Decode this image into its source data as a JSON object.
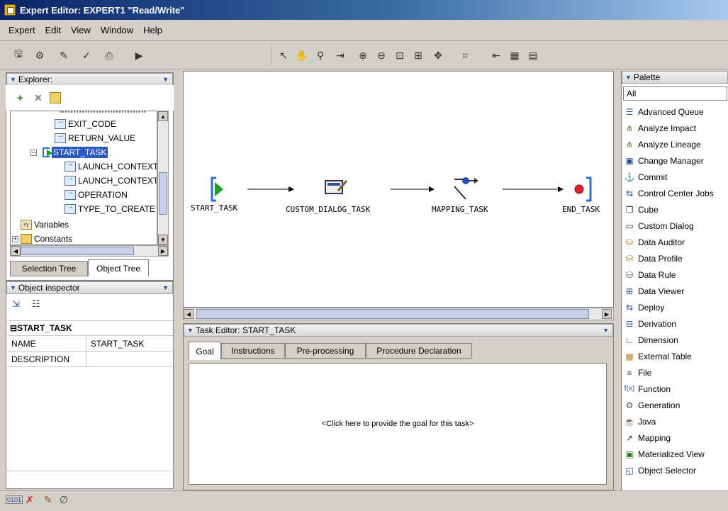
{
  "window": {
    "title": "Expert Editor: EXPERT1 \"Read/Write\""
  },
  "menu": [
    "Expert",
    "Edit",
    "View",
    "Window",
    "Help"
  ],
  "explorer": {
    "title": "Explorer:",
    "tree": [
      {
        "label": "EXIT_CODE",
        "type": "variable"
      },
      {
        "label": "RETURN_VALUE",
        "type": "variable"
      },
      {
        "label": "START_TASK",
        "type": "task",
        "selected": true
      },
      {
        "label": "LAUNCH_CONTEXT",
        "type": "variable"
      },
      {
        "label": "LAUNCH_CONTEXT",
        "type": "variable"
      },
      {
        "label": "OPERATION",
        "type": "variable"
      },
      {
        "label": "TYPE_TO_CREATE",
        "type": "variable"
      },
      {
        "label": "Variables",
        "type": "xy"
      },
      {
        "label": "Constants",
        "type": "folder"
      }
    ],
    "tabs": [
      "Selection Tree",
      "Object Tree"
    ],
    "active_tab": "Object Tree"
  },
  "inspector": {
    "title": "Object inspector",
    "object": "START_TASK",
    "properties": [
      {
        "name": "NAME",
        "value": "START_TASK"
      },
      {
        "name": "DESCRIPTION",
        "value": ""
      }
    ]
  },
  "canvas": {
    "nodes": [
      "START_TASK",
      "CUSTOM_DIALOG_TASK",
      "MAPPING_TASK",
      "END_TASK"
    ]
  },
  "task_editor": {
    "title": "Task Editor: START_TASK",
    "tabs": [
      "Goal",
      "Instructions",
      "Pre-processing",
      "Procedure Declaration"
    ],
    "active_tab": "Goal",
    "goal_prompt": "<Click here to provide the goal for this task>"
  },
  "palette": {
    "title": "Palette",
    "filter": "All",
    "items": [
      "Advanced Queue",
      "Analyze Impact",
      "Analyze Lineage",
      "Change Manager",
      "Commit",
      "Control Center Jobs",
      "Cube",
      "Custom Dialog",
      "Data Auditor",
      "Data Profile",
      "Data Rule",
      "Data Viewer",
      "Deploy",
      "Derivation",
      "Dimension",
      "External Table",
      "File",
      "Function",
      "Generation",
      "Java",
      "Mapping",
      "Materialized View",
      "Object Selector"
    ]
  },
  "colors": {
    "selection": "#2a5ac0",
    "title_bar": "#0a246a",
    "end_node": "#e02020",
    "start_node": "#18a018"
  }
}
